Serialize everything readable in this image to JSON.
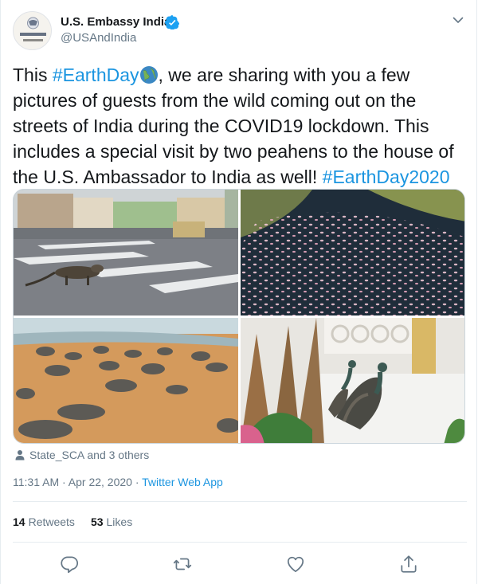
{
  "account": {
    "name": "U.S. Embassy India",
    "handle": "@USAndIndia",
    "avatar_text_top": "U.S. EMBASSY",
    "avatar_text_bottom": "New Delhi"
  },
  "tweet": {
    "text_part1": "This ",
    "hashtag1": "#EarthDay",
    "text_part2": ", we are sharing with you a few pictures of guests from the wild coming out on the streets of India during the COVID19 lockdown. This includes a special visit by two peahens to the house of the U.S. Ambassador to India as well! ",
    "hashtag2": "#EarthDay2020"
  },
  "tagged": "State_SCA and 3 others",
  "meta": {
    "time": "11:31 AM · Apr 22, 2020 · ",
    "app": "Twitter Web App"
  },
  "stats": {
    "retweets_count": "14",
    "retweets_label": "Retweets",
    "likes_count": "53",
    "likes_label": "Likes"
  },
  "icons": [
    "verified-icon",
    "caret-down-icon",
    "globe-icon",
    "person-icon",
    "reply-icon",
    "retweet-icon",
    "like-icon",
    "share-icon"
  ],
  "colors": {
    "link": "#1b95e0",
    "secondary": "#657786",
    "border": "#e6ecf0",
    "verified": "#1da1f2"
  }
}
